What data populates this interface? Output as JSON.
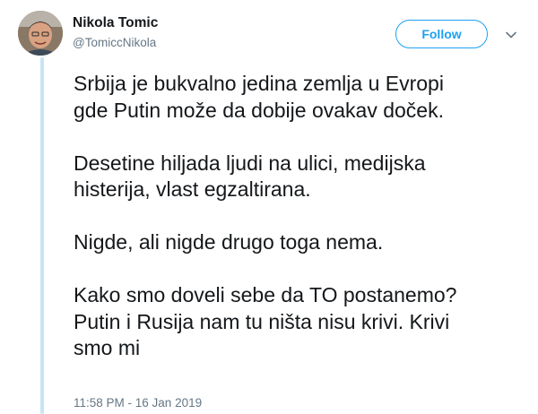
{
  "author": {
    "name": "Nikola Tomic",
    "handle": "@TomiccNikola"
  },
  "follow_label": "Follow",
  "tweet": {
    "lines": [
      "Srbija je bukvalno jedina zemlja u Evropi",
      "gde Putin može da dobije ovakav doček.",
      "Desetine hiljada ljudi na ulici, medijska",
      "histerija, vlast egzaltirana.",
      "Nigde, ali nigde drugo toga nema.",
      "Kako smo doveli sebe da TO postanemo?",
      "Putin i Rusija nam tu ništa nisu krivi. Krivi",
      "smo mi"
    ]
  },
  "timestamp": "11:58 PM - 16 Jan 2019",
  "colors": {
    "accent": "#1da1f2",
    "thread_line": "#c7e4f7",
    "secondary_text": "#657786",
    "primary_text": "#14171a"
  },
  "icons": {
    "menu": "chevron-down-icon"
  }
}
